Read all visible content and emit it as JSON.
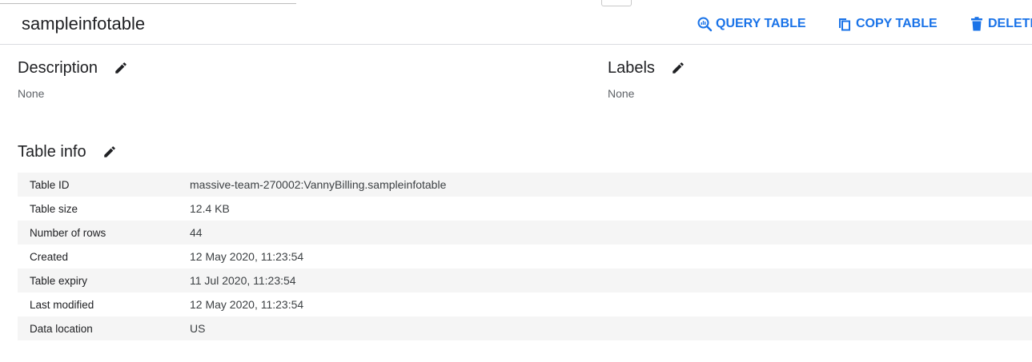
{
  "header": {
    "title": "sampleinfotable",
    "actions": {
      "query": "QUERY TABLE",
      "copy": "COPY TABLE",
      "delete": "DELETE"
    }
  },
  "description": {
    "heading": "Description",
    "value": "None"
  },
  "labels": {
    "heading": "Labels",
    "value": "None"
  },
  "table_info": {
    "heading": "Table info",
    "rows": [
      {
        "key": "Table ID",
        "value": "massive-team-270002:VannyBilling.sampleinfotable"
      },
      {
        "key": "Table size",
        "value": "12.4 KB"
      },
      {
        "key": "Number of rows",
        "value": "44"
      },
      {
        "key": "Created",
        "value": "12 May 2020, 11:23:54"
      },
      {
        "key": "Table expiry",
        "value": "11 Jul 2020, 11:23:54"
      },
      {
        "key": "Last modified",
        "value": "12 May 2020, 11:23:54"
      },
      {
        "key": "Data location",
        "value": "US"
      }
    ]
  },
  "colors": {
    "accent": "#1a73e8",
    "row_stripe": "#f5f5f5",
    "muted_text": "#5f6368"
  },
  "icons": [
    "query-icon",
    "copy-icon",
    "delete-icon",
    "edit-pencil-icon"
  ]
}
